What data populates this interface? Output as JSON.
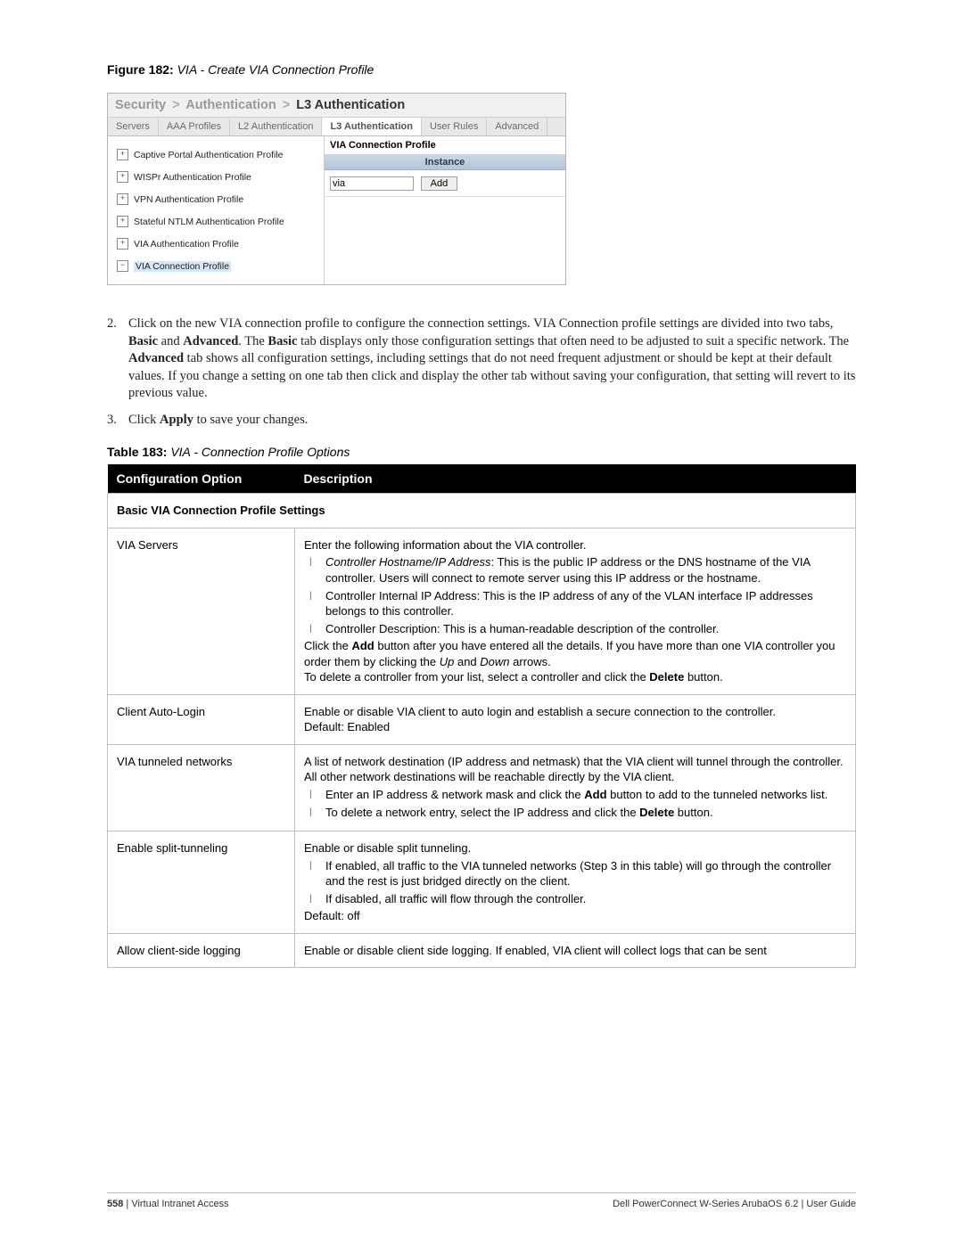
{
  "figure": {
    "label": "Figure 182:",
    "title": "VIA - Create VIA Connection Profile"
  },
  "shot": {
    "breadcrumb": {
      "c1": "Security",
      "c2": "Authentication",
      "c3": "L3 Authentication",
      "sep": ">"
    },
    "tabs": {
      "t0": "Servers",
      "t1": "AAA Profiles",
      "t2": "L2 Authentication",
      "t3": "L3 Authentication",
      "t4": "User Rules",
      "t5": "Advanced"
    },
    "tree": {
      "i0": "Captive Portal Authentication Profile",
      "i1": "WISPr Authentication Profile",
      "i2": "VPN Authentication Profile",
      "i3": "Stateful NTLM Authentication Profile",
      "i4": "VIA Authentication Profile",
      "i5": "VIA Connection Profile"
    },
    "profile_title": "VIA Connection Profile",
    "instance_header": "Instance",
    "input_value": "via",
    "add_button": "Add"
  },
  "para2_num": "2.",
  "para2_a": "Click on the new VIA connection profile to configure the connection settings. VIA Connection profile settings are divided into two tabs, ",
  "para2_b": "Basic",
  "para2_c": " and ",
  "para2_d": "Advanced",
  "para2_e": ". The ",
  "para2_f": "Basic",
  "para2_g": " tab displays only those configuration settings that often need to be adjusted to suit a specific network. The ",
  "para2_h": "Advanced",
  "para2_i": " tab shows all configuration settings, including settings that do not need frequent adjustment or should be kept at their default values. If you change a setting on one tab then click and display the other tab without saving your configuration, that setting will revert to its previous value.",
  "para3_num": "3.",
  "para3_a": "Click ",
  "para3_b": "Apply",
  "para3_c": " to save your changes.",
  "tablecap": {
    "label": "Table 183:",
    "title": "VIA - Connection Profile Options"
  },
  "table": {
    "h1": "Configuration Option",
    "h2": "Description",
    "section1": "Basic VIA Connection Profile Settings",
    "r1_opt": "VIA Servers",
    "r1_intro": "Enter the following information about the VIA controller.",
    "r1_b1_a": "Controller Hostname/IP Address",
    "r1_b1_b": ": This is the public IP address or the DNS hostname of the VIA controller. Users will connect to remote server using this IP address or the hostname.",
    "r1_b2": "Controller Internal IP Address: This is the IP address of any of the VLAN interface IP addresses belongs to this controller.",
    "r1_b3": "Controller Description: This is a human-readable description of the controller.",
    "r1_p2_a": "Click the ",
    "r1_p2_b": "Add",
    "r1_p2_c": " button after you have entered all the details. If you have more than one VIA controller you order them by clicking the ",
    "r1_p2_d": "Up",
    "r1_p2_e": " and ",
    "r1_p2_f": "Down",
    "r1_p2_g": " arrows.",
    "r1_p3_a": "To delete a controller from your list, select a controller and click the ",
    "r1_p3_b": "Delete",
    "r1_p3_c": " button.",
    "r2_opt": "Client Auto-Login",
    "r2_desc": "Enable or disable VIA client to auto login and establish a secure connection to the controller.",
    "r2_def": "Default: Enabled",
    "r3_opt": "VIA tunneled networks",
    "r3_p1": "A list of network destination (IP address and netmask) that the VIA client will tunnel through the controller. All other network destinations will be reachable directly by the VIA client.",
    "r3_b1_a": "Enter an IP address & network mask and click the ",
    "r3_b1_b": "Add",
    "r3_b1_c": " button to add to the tunneled networks list.",
    "r3_b2_a": "To delete a network entry, select the IP address and click the ",
    "r3_b2_b": "Delete",
    "r3_b2_c": " button.",
    "r4_opt": "Enable split-tunneling",
    "r4_p1": "Enable or disable split tunneling.",
    "r4_b1": "If enabled, all traffic to the VIA tunneled networks (Step 3 in this table) will go through the controller and the rest is just bridged directly on the client.",
    "r4_b2": "If disabled, all traffic will flow through the controller.",
    "r4_def": "Default: off",
    "r5_opt": "Allow client-side logging",
    "r5_desc": "Enable or disable client side logging. If enabled, VIA client will collect logs that can be sent"
  },
  "footer": {
    "page": "558",
    "sep": " | ",
    "section": "Virtual Intranet Access",
    "right": "Dell PowerConnect W-Series ArubaOS 6.2  |  User Guide"
  }
}
